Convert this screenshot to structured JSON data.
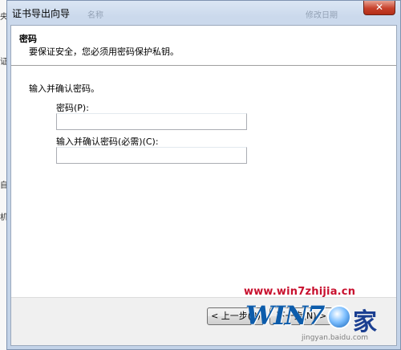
{
  "window": {
    "title": "证书导出向导",
    "ghost_columns": [
      "名称",
      "修改日期"
    ],
    "close_glyph": "✕"
  },
  "background_edge_chars": [
    "央",
    "证",
    "自",
    "机"
  ],
  "header": {
    "title": "密码",
    "description": "要保证安全，您必须用密码保护私钥。"
  },
  "body": {
    "instruction": "输入并确认密码。",
    "password_label": "密码(P):",
    "password_value": "",
    "confirm_label": "输入并确认密码(必需)(C):",
    "confirm_value": ""
  },
  "buttons": {
    "back": "< 上一步(B)",
    "next": "下一步(N) >"
  },
  "watermark": {
    "url": "www.win7zhijia.cn",
    "logo_text": "WIN7",
    "logo_home": "家",
    "site": "jingyan.baidu.com"
  },
  "colors": {
    "title_bar": "#c3d3e8",
    "close_button": "#c7412b",
    "watermark_red": "#c8102e",
    "watermark_blue": "#0d5cab"
  }
}
